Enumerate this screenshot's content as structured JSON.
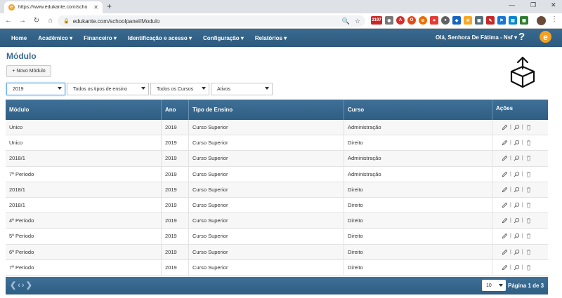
{
  "browser": {
    "tab_title": "https://www.edukante.com/scho",
    "url": "edukante.com/schoolpanel/Modulo",
    "favicon_letter": "e",
    "new_tab": "+",
    "ext_badge": "2197"
  },
  "nav": {
    "items": [
      {
        "label": "Home"
      },
      {
        "label": "Acadêmico ▾"
      },
      {
        "label": "Financeiro ▾"
      },
      {
        "label": "Identificação e acesso ▾"
      },
      {
        "label": "Configuração ▾"
      },
      {
        "label": "Relatórios ▾"
      }
    ],
    "user": "Olá, Senhora De Fátima - Nsf ▾",
    "help": "?",
    "brand": "e"
  },
  "page": {
    "title": "Módulo",
    "new_button": "+ Novo Módulo"
  },
  "filters": {
    "year": "2019",
    "ensino": "Todos os tipos de ensino",
    "cursos": "Todos os Cursos",
    "status": "Ativos"
  },
  "table": {
    "headers": [
      "Módulo",
      "Ano",
      "Tipo de Ensino",
      "Curso",
      "Ações"
    ],
    "rows": [
      [
        "Unico",
        "2019",
        "Curso Superior",
        "Administração"
      ],
      [
        "Unico",
        "2019",
        "Curso Superior",
        "Direito"
      ],
      [
        "2018/1",
        "2019",
        "Curso Superior",
        "Administração"
      ],
      [
        "7º Período",
        "2019",
        "Curso Superior",
        "Administração"
      ],
      [
        "2018/1",
        "2019",
        "Curso Superior",
        "Direito"
      ],
      [
        "2018/1",
        "2019",
        "Curso Superior",
        "Direito"
      ],
      [
        "4º Período",
        "2019",
        "Curso Superior",
        "Direito"
      ],
      [
        "5º Período",
        "2019",
        "Curso Superior",
        "Direito"
      ],
      [
        "6º Período",
        "2019",
        "Curso Superior",
        "Direito"
      ],
      [
        "7º Período",
        "2019",
        "Curso Superior",
        "Direito"
      ]
    ],
    "action_sep": "|"
  },
  "footer": {
    "page_size": "10",
    "page_info": "Página 1 de 3"
  },
  "colors": {
    "nav_bg": "#2d5a7e",
    "accent": "#3a6a90",
    "brand": "#f4a020"
  }
}
